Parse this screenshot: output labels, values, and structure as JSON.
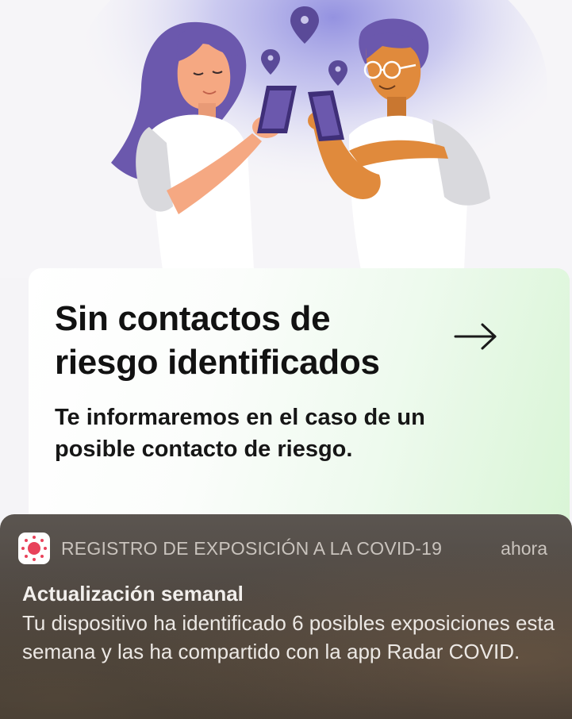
{
  "illustration": {
    "name": "two-people-with-phones-illustration",
    "colors": {
      "purple": "#6b58ad",
      "dark_purple": "#3f2f78",
      "skin_light": "#f5a882",
      "skin_dark": "#e08a3c",
      "shirt": "#ffffff",
      "sleeve": "#d9d9dd",
      "glow": "#c7c6ef"
    }
  },
  "status_card": {
    "title": "Sin contactos de riesgo identificados",
    "subtitle": "Te informaremos en el caso de un posible contacto de riesgo.",
    "arrow_icon": "arrow-right-icon",
    "accent_color": "#d9f5d6"
  },
  "notification": {
    "app_icon": "radar-covid-icon",
    "app_name": "REGISTRO DE EXPOSICIÓN A LA COVID-19",
    "time": "ahora",
    "title": "Actualización semanal",
    "body": "Tu dispositivo ha identificado 6 posibles exposiciones esta semana y las ha compartido con la app Radar COVID."
  }
}
